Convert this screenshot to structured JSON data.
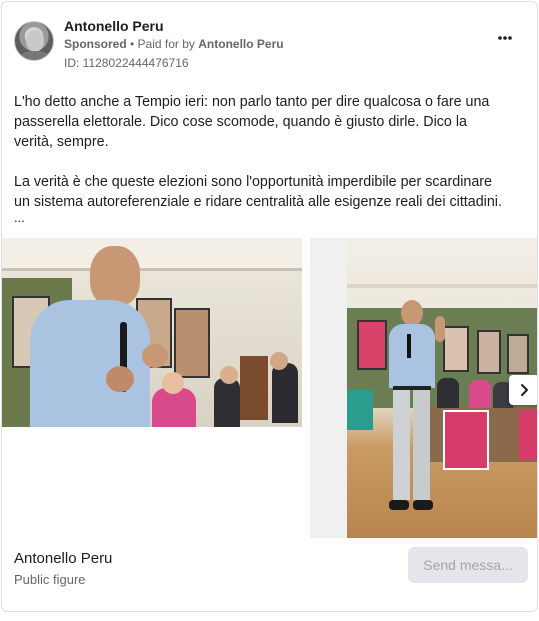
{
  "post": {
    "page_name": "Antonello Peru",
    "sponsored_label": "Sponsored",
    "separator": " • ",
    "paid_for_prefix": "Paid for by ",
    "paid_for_name": "Antonello Peru",
    "ad_id": "ID: 1128022444476716",
    "more_icon": "more-horizontal-icon",
    "paragraphs": [
      "L'ho detto anche a Tempio ieri: non parlo tanto per dire qualcosa o fare una passerella elettorale. Dico cose scomode, quando è giusto dirle. Dico la verità, sempre.",
      "La verità è che queste elezioni sono l'opportunità imperdibile per scardinare un sistema autoreferenziale e ridare centralità alle esigenze reali dei cittadini."
    ],
    "ellipsis": "..."
  },
  "carousel": {
    "next_icon": "chevron-right-icon"
  },
  "footer": {
    "name": "Antonello Peru",
    "category": "Public figure",
    "send_button": "Send messa..."
  },
  "colors": {
    "text_primary": "#1c1e21",
    "text_secondary": "#65676b",
    "button_bg": "#e4e6eb",
    "button_text_disabled": "#a3a6ab",
    "border": "#dddfe2"
  }
}
